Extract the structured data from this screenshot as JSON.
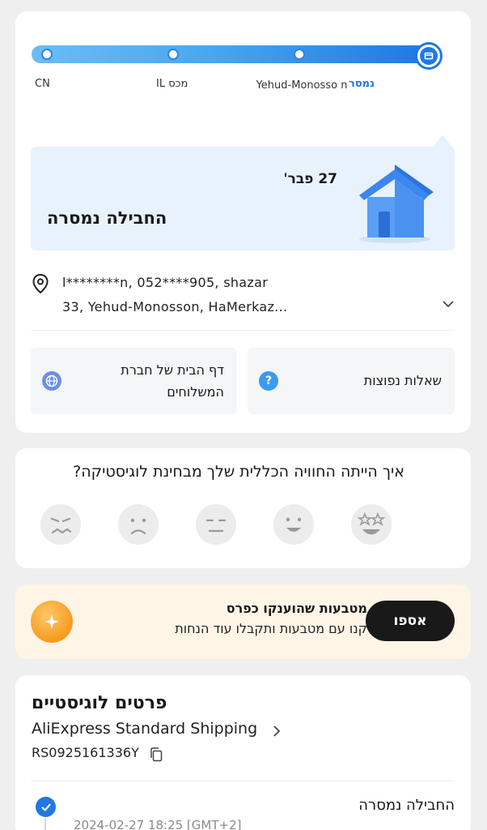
{
  "progress": {
    "stages": [
      {
        "label": "CN"
      },
      {
        "label": "מכס IL"
      },
      {
        "label": "Yehud-Monosso n"
      },
      {
        "label": "נמסר",
        "active": true
      }
    ],
    "accent": "#1f78e4"
  },
  "delivery": {
    "date": "27 פבר'",
    "status": "החבילה נמסרה",
    "icon": "house-icon"
  },
  "address": {
    "line1": "l********n, 052****905, shazar",
    "line2": "33, Yehud-Monosson, HaMerkaz..."
  },
  "tiles": {
    "faq": "שאלות נפוצות",
    "carrier_home_line1": "דף הבית של חברת",
    "carrier_home_line2": "המשלוחים"
  },
  "feedback": {
    "question": "איך הייתה החוויה הכללית שלך מבחינת לוגיסטיקה?",
    "faces": [
      "very-bad-face-icon",
      "bad-face-icon",
      "neutral-face-icon",
      "good-face-icon",
      "excellent-face-icon"
    ]
  },
  "coins": {
    "title": "מטבעות שהוענקו כפרס",
    "subtitle": "קנו עם מטבעות ותקבלו עוד הנחות",
    "button": "אספו"
  },
  "logistics": {
    "title": "פרטים לוגיסטיים",
    "carrier": "AliExpress Standard Shipping",
    "tracking_number": "RS0925161336Y",
    "events": [
      {
        "status": "החבילה נמסרה",
        "date": "2024-02-27 18:25 [GMT+2]"
      }
    ]
  }
}
